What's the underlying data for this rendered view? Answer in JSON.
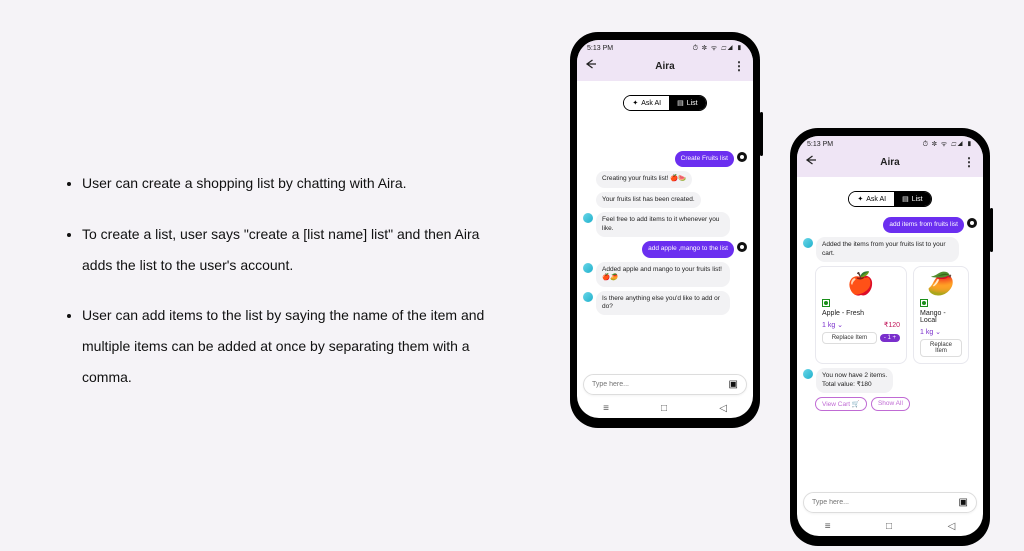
{
  "bullets": [
    "User can create a shopping list by chatting with Aira.",
    "To create a list, user says \"create a [list name] list\" and then Aira adds the list to the user's account.",
    "User can add items to the list by saying the name of the item and multiple items can be added at once by separating them with a comma."
  ],
  "phone": {
    "status_time": "5:13 PM",
    "status_icons": "⏱ ✽ ᯤ ▱◢ ▮",
    "header_title": "Aira",
    "mode_ask": "Ask AI",
    "mode_list": "List",
    "input_placeholder": "Type here..."
  },
  "phone1_chat": {
    "msg_user1": "Create Fruits list",
    "msg_ai1": "Creating your fruits list! 🍎🍉",
    "msg_ai2": "Your fruits list has been created.",
    "msg_ai3": "Feel free to add items to it whenever you like.",
    "msg_user2": "add apple ,mango to the list",
    "msg_ai4": "Added apple and mango to your fruits list! 🍎🥭",
    "msg_ai5": "Is there anything else you'd like to add or do?"
  },
  "phone2_chat": {
    "msg_user1": "add items from fruits list",
    "msg_ai1": "Added the items from your fruits list to your cart.",
    "card1": {
      "emoji": "🍎",
      "name": "Apple - Fresh",
      "weight": "1 kg ⌄",
      "price": "₹120",
      "replace": "Replace Item",
      "qty": "- 1 +"
    },
    "card2": {
      "emoji": "🥭",
      "name": "Mango - Local",
      "weight": "1 kg ⌄",
      "replace": "Replace Item"
    },
    "summary1": "You now have 2 items.",
    "summary2": "Total value: ₹180",
    "btn_viewcart": "View Cart 🛒",
    "btn_showall": "Show All"
  }
}
